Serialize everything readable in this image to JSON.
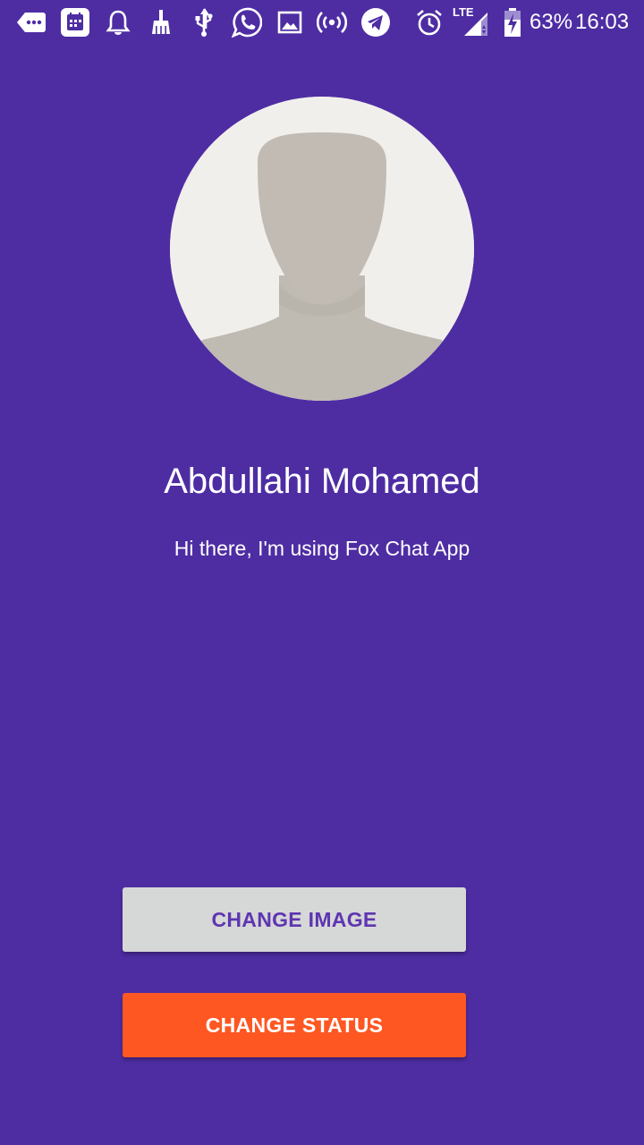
{
  "status_bar": {
    "icons": [
      "messages-icon",
      "calendar-icon",
      "bell-icon",
      "broom-icon",
      "usb-icon",
      "whatsapp-icon",
      "image-icon",
      "hotspot-icon",
      "telegram-icon",
      "alarm-icon",
      "lte-signal-icon",
      "battery-charging-icon"
    ],
    "network_type": "LTE",
    "battery_percent": "63%",
    "time": "16:03"
  },
  "profile": {
    "avatar_icon": "default-avatar-icon",
    "display_name": "Abdullahi Mohamed",
    "status": "Hi there, I'm using Fox Chat App"
  },
  "actions": {
    "change_image_label": "CHANGE IMAGE",
    "change_status_label": "CHANGE STATUS"
  },
  "colors": {
    "background": "#4E2DA3",
    "change_image_button": "#D6D7D7",
    "change_image_text": "#5E35B1",
    "change_status_button": "#FF5722",
    "change_status_text": "#FFFFFF"
  }
}
